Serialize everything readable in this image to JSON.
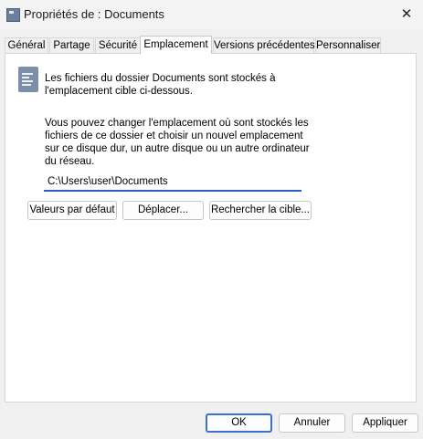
{
  "window": {
    "title": "Propriétés de : Documents",
    "close_icon": "close-icon"
  },
  "tabs": [
    {
      "label": "Général"
    },
    {
      "label": "Partage"
    },
    {
      "label": "Sécurité"
    },
    {
      "label": "Emplacement",
      "active": true
    },
    {
      "label": "Versions précédentes"
    },
    {
      "label": "Personnaliser"
    }
  ],
  "location": {
    "folder_icon": "folder-location-icon",
    "info": "Les fichiers du dossier Documents sont stockés à l'emplacement cible ci-dessous.",
    "description": "Vous pouvez changer l'emplacement où sont stockés les fichiers de ce dossier et choisir un nouvel emplacement sur ce disque dur, un autre disque ou un autre ordinateur du réseau.",
    "path_value": "C:\\Users\\user\\Documents",
    "buttons": {
      "restore_default": "Valeurs par défaut",
      "move": "Déplacer...",
      "find_target": "Rechercher la cible..."
    }
  },
  "footer": {
    "ok": "OK",
    "cancel": "Annuler",
    "apply": "Appliquer"
  },
  "colors": {
    "accent": "#2b5fc7"
  }
}
